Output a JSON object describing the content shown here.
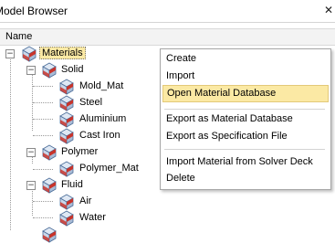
{
  "panel": {
    "title": "Model Browser",
    "close_glyph": "✕"
  },
  "header": {
    "name_column": "Name"
  },
  "tree": {
    "root": {
      "label": "Materials",
      "toggle": "−"
    },
    "solid": {
      "label": "Solid",
      "toggle": "−",
      "children": [
        "Mold_Mat",
        "Steel",
        "Aluminium",
        "Cast Iron"
      ]
    },
    "polymer": {
      "label": "Polymer",
      "toggle": "−",
      "children": [
        "Polymer_Mat"
      ]
    },
    "fluid": {
      "label": "Fluid",
      "toggle": "−",
      "children": [
        "Air",
        "Water"
      ]
    }
  },
  "context_menu": {
    "items": [
      "Create",
      "Import",
      "Open Material Database",
      "Export as Material Database",
      "Export as Specification File",
      "Import Material from Solver Deck",
      "Delete"
    ],
    "highlighted": "Open Material Database"
  },
  "colors": {
    "highlight": "#fbe9a4",
    "menu_border": "#a6a6a6"
  }
}
